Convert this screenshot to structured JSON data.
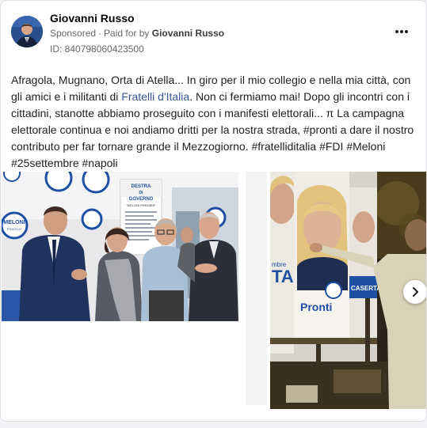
{
  "post": {
    "author_name": "Giovanni Russo",
    "sponsored_label": "Sponsored",
    "paid_for_prefix": "Paid for by",
    "paid_for_name": "Giovanni Russo",
    "library_id": "ID: 840798060423500",
    "caption_part1": "Afragola, Mugnano, Orta di Atella... In giro per il mio collegio e nella mia città, con gli amici e i militanti di ",
    "caption_link": "Fratelli d'Italia",
    "caption_part2": ". Non ci fermiamo mai! Dopo gli incontri con i cittadini, stanotte abbiamo proseguito con i manifesti elettorali... π La campagna elettorale continua e noi andiamo dritti per la nostra strada, #pronti a dare il nostro contributo per far tornare grande il Mezzogiorno. #fratelliditalia #FDI #Meloni #25settembre #napoli"
  },
  "media": {
    "photo1_poster_text": [
      "DESTRA",
      "DI",
      "GOVERNO",
      "\"MELONI PREMIER\""
    ],
    "photo1_logo_text": [
      "MELONI",
      "FRATELLI",
      "D'ITALIA"
    ],
    "photo2_poster_text": [
      "Pronti",
      "CASERTA",
      "TA",
      "mbre"
    ]
  },
  "icons": {
    "more": "more-options-icon",
    "next": "chevron-right-icon",
    "avatar": "author-avatar"
  },
  "colors": {
    "link": "#385898",
    "muted": "#65676b",
    "text": "#1c1e21",
    "fdi_blue": "#1e4fa3"
  }
}
